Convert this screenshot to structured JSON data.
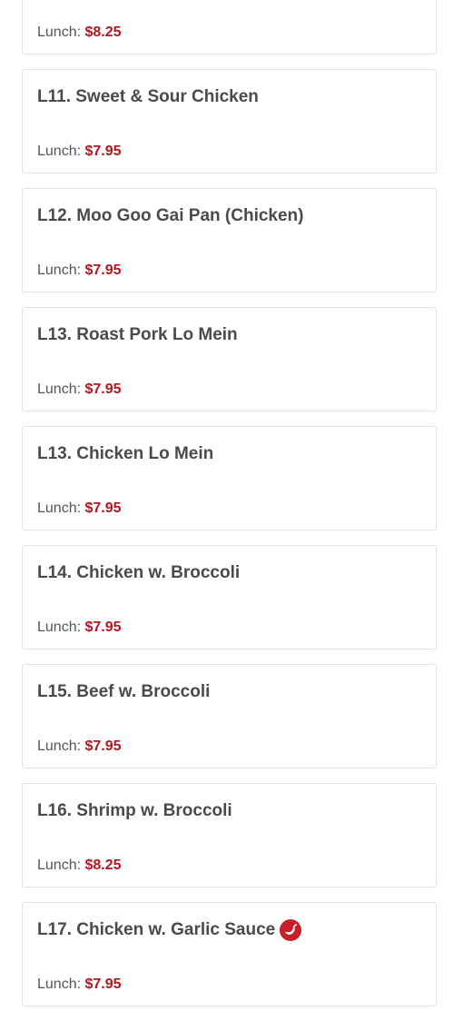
{
  "menu": {
    "items": [
      {
        "name": "",
        "price_label": "Lunch:",
        "price": "$8.25",
        "spicy": false
      },
      {
        "name": "L11. Sweet & Sour Chicken",
        "price_label": "Lunch:",
        "price": "$7.95",
        "spicy": false
      },
      {
        "name": "L12. Moo Goo Gai Pan (Chicken)",
        "price_label": "Lunch:",
        "price": "$7.95",
        "spicy": false
      },
      {
        "name": "L13. Roast Pork Lo Mein",
        "price_label": "Lunch:",
        "price": "$7.95",
        "spicy": false
      },
      {
        "name": "L13. Chicken Lo Mein",
        "price_label": "Lunch:",
        "price": "$7.95",
        "spicy": false
      },
      {
        "name": "L14. Chicken w. Broccoli",
        "price_label": "Lunch:",
        "price": "$7.95",
        "spicy": false
      },
      {
        "name": "L15. Beef w. Broccoli",
        "price_label": "Lunch:",
        "price": "$7.95",
        "spicy": false
      },
      {
        "name": "L16. Shrimp w. Broccoli",
        "price_label": "Lunch:",
        "price": "$8.25",
        "spicy": false
      },
      {
        "name": "L17. Chicken w. Garlic Sauce",
        "price_label": "Lunch:",
        "price": "$7.95",
        "spicy": true
      }
    ]
  },
  "icons": {
    "spicy": "chili-pepper-icon"
  },
  "colors": {
    "price": "#b5141e",
    "title": "#4a4a4a",
    "border": "#e2e2e2"
  }
}
